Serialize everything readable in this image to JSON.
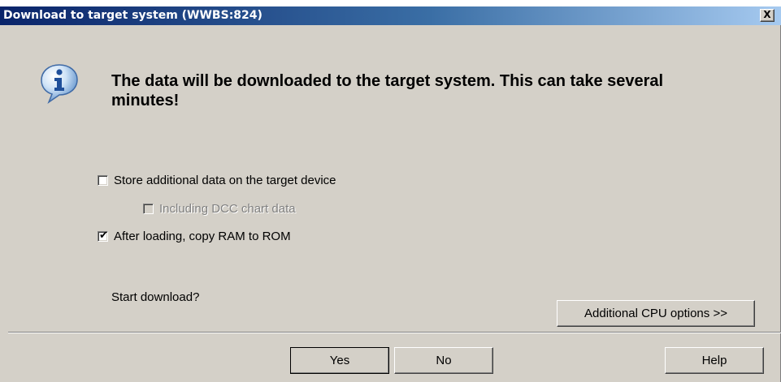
{
  "window": {
    "title": "Download to target system (WWBS:824)",
    "close_label": "X"
  },
  "message": {
    "icon": "info-icon",
    "text": "The data will be downloaded to the target system. This can take several minutes!"
  },
  "options": {
    "store_additional": {
      "label": "Store additional data on the target device",
      "checked": false,
      "enabled": true
    },
    "include_dcc": {
      "label": "Including DCC chart data",
      "checked": false,
      "enabled": false
    },
    "copy_ram_to_rom": {
      "label": "After loading, copy RAM to ROM",
      "checked": true,
      "enabled": true,
      "check_glyph": "✔"
    }
  },
  "prompt": "Start download?",
  "buttons": {
    "additional_cpu": "Additional CPU options >>",
    "yes": "Yes",
    "no": "No",
    "help": "Help"
  }
}
